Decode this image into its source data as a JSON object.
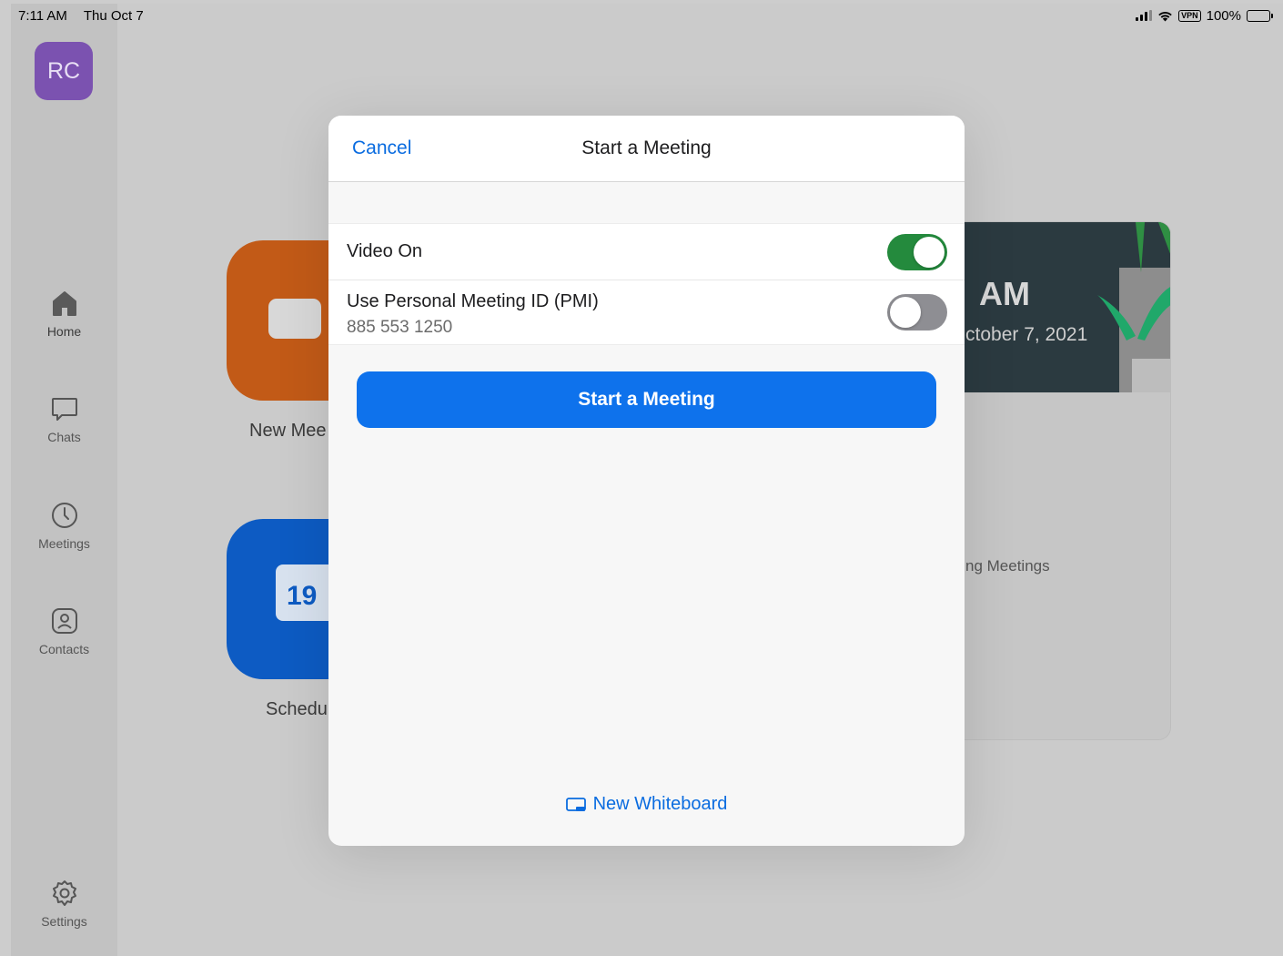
{
  "status_bar": {
    "time": "7:11 AM",
    "date": "Thu Oct 7",
    "vpn": "VPN",
    "battery": "100%"
  },
  "sidebar": {
    "avatar_initials": "RC",
    "items": [
      {
        "label": "Home",
        "icon": "home-icon"
      },
      {
        "label": "Chats",
        "icon": "chat-bubble-icon"
      },
      {
        "label": "Meetings",
        "icon": "clock-icon"
      },
      {
        "label": "Contacts",
        "icon": "contact-icon"
      },
      {
        "label": "Settings",
        "icon": "gear-icon"
      }
    ]
  },
  "background": {
    "new_meeting_label": "New Mee",
    "schedule_label": "Schedu",
    "calendar_day": "19",
    "card_time": "AM",
    "card_date": "ctober 7, 2021",
    "card_upcoming": "ng Meetings"
  },
  "modal": {
    "cancel_label": "Cancel",
    "title": "Start a Meeting",
    "video_on_label": "Video On",
    "video_on": true,
    "pmi_label": "Use Personal Meeting ID (PMI)",
    "pmi_number": "885 553 1250",
    "pmi_on": false,
    "start_button_label": "Start a Meeting",
    "whiteboard_label": "New Whiteboard"
  },
  "colors": {
    "accent": "#0e72ec",
    "link": "#0a6ce0",
    "toggle_on": "#248a3d",
    "toggle_off": "#8e8e93"
  }
}
